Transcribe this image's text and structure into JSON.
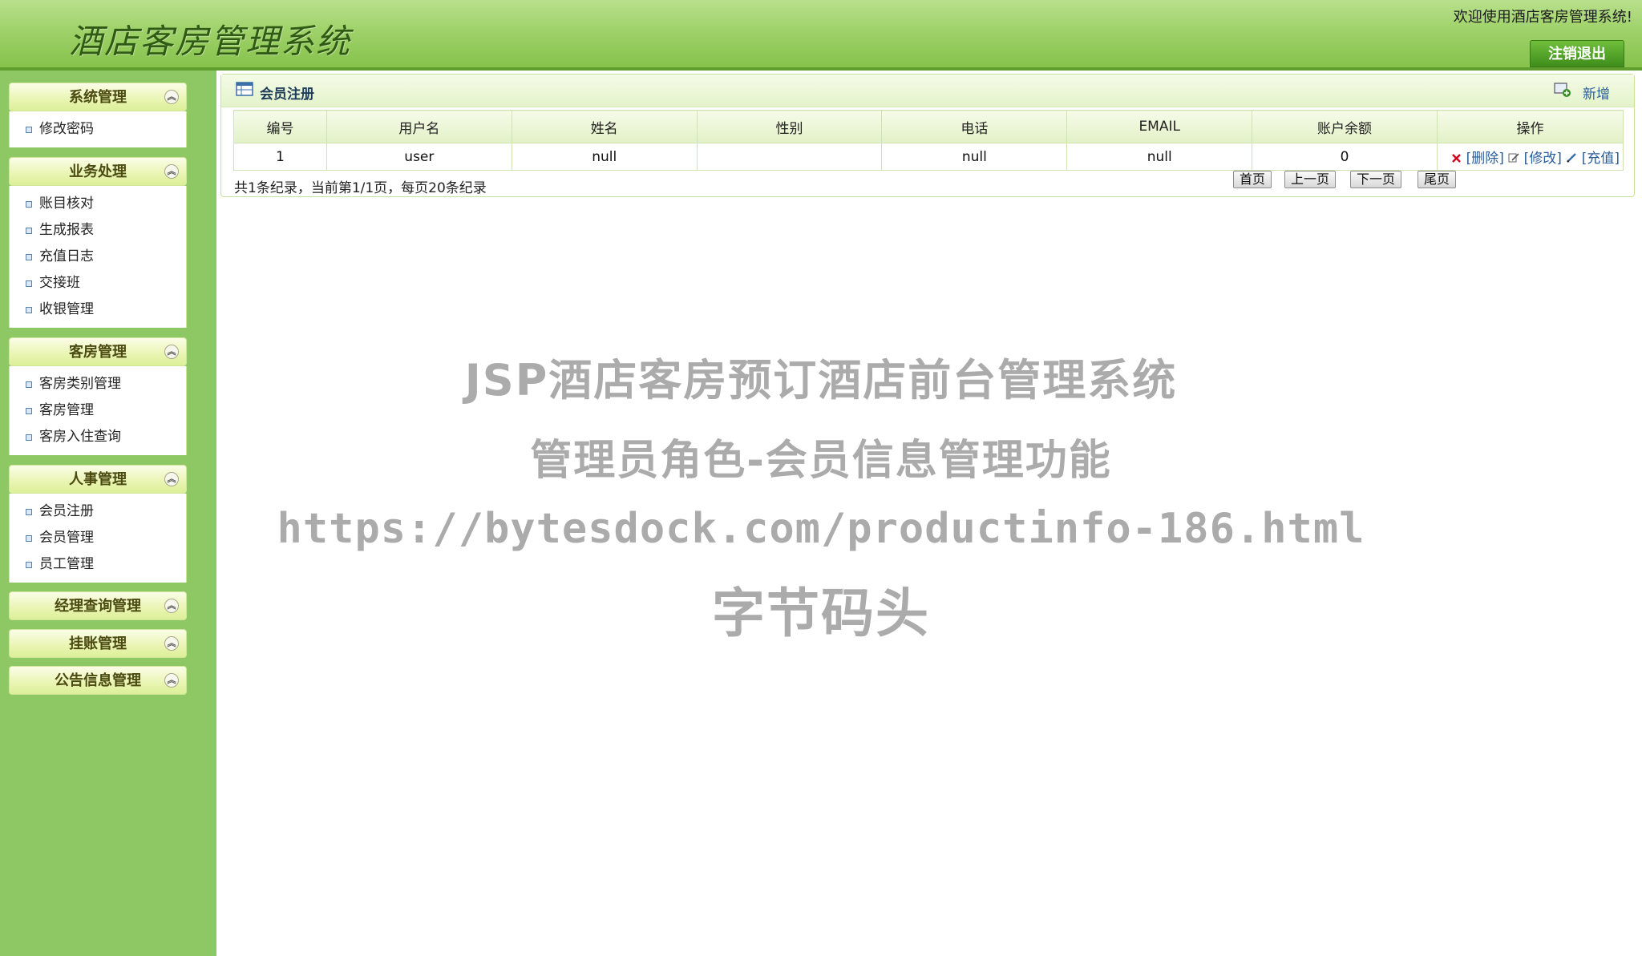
{
  "header": {
    "title": "酒店客房管理系统",
    "welcome": "欢迎使用酒店客房管理系统!",
    "logout_label": "注销退出"
  },
  "sidebar": {
    "groups": [
      {
        "title": "系统管理",
        "items": [
          "修改密码"
        ]
      },
      {
        "title": "业务处理",
        "items": [
          "账目核对",
          "生成报表",
          "充值日志",
          "交接班",
          "收银管理"
        ]
      },
      {
        "title": "客房管理",
        "items": [
          "客房类别管理",
          "客房管理",
          "客房入住查询"
        ]
      },
      {
        "title": "人事管理",
        "items": [
          "会员注册",
          "会员管理",
          "员工管理"
        ]
      },
      {
        "title": "经理查询管理",
        "items": []
      },
      {
        "title": "挂账管理",
        "items": []
      },
      {
        "title": "公告信息管理",
        "items": []
      }
    ],
    "collapse_icon": "double-chevron-up-icon"
  },
  "panel": {
    "title": "会员注册",
    "add_label": "新增",
    "columns": [
      "编号",
      "用户名",
      "姓名",
      "性别",
      "电话",
      "EMAIL",
      "账户余额",
      "操作"
    ],
    "rows": [
      {
        "id": "1",
        "username": "user",
        "name": "null",
        "gender": "",
        "phone": "null",
        "email": "null",
        "balance": "0"
      }
    ],
    "ops": {
      "delete": "[删除]",
      "edit": "[修改]",
      "recharge": "[充值]"
    },
    "pager": {
      "summary": "共1条纪录，当前第1/1页，每页20条纪录",
      "first": "首页",
      "prev": "上一页",
      "next": "下一页",
      "last": "尾页"
    }
  },
  "watermark": {
    "line1": "JSP酒店客房预订酒店前台管理系统",
    "line2": "管理员角色-会员信息管理功能",
    "line3": "https://bytesdock.com/productinfo-186.html",
    "line4": "字节码头"
  },
  "colors": {
    "header_green": "#9fd26a",
    "sidebar_green": "#8ec865",
    "link_blue": "#2a5d9c",
    "delete_red": "#d0021b"
  }
}
